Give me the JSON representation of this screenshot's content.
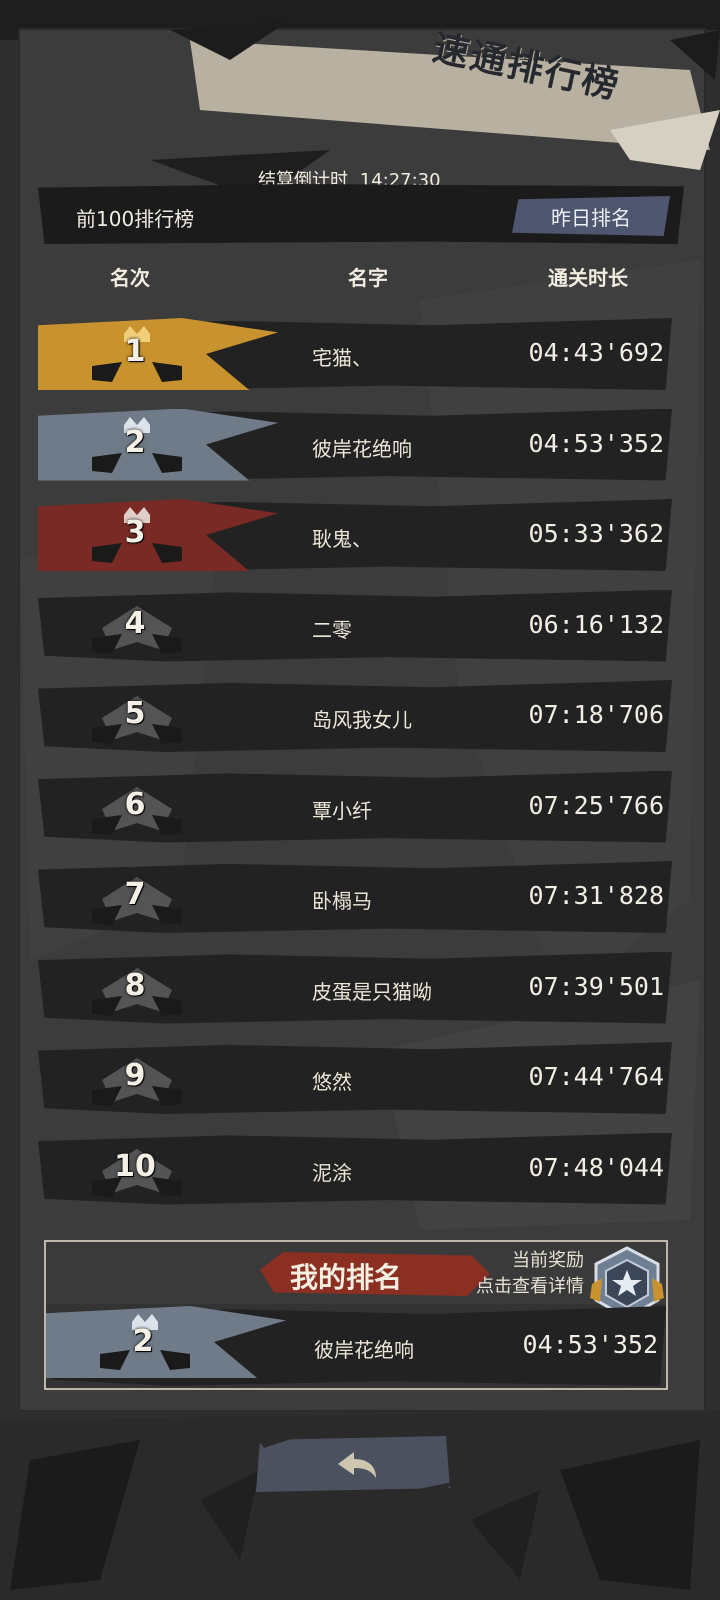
{
  "title": "速通排行榜",
  "countdown": {
    "label": "结算倒计时",
    "value": "14:27:30"
  },
  "board": {
    "label": "前100排行榜",
    "yesterday_button": "昨日排名",
    "columns": {
      "rank": "名次",
      "name": "名字",
      "time": "通关时长"
    }
  },
  "rows": [
    {
      "rank": "1",
      "name": "宅猫、",
      "time": "04:43'692",
      "tier": "gold"
    },
    {
      "rank": "2",
      "name": "彼岸花绝响",
      "time": "04:53'352",
      "tier": "silver"
    },
    {
      "rank": "3",
      "name": "耿鬼、",
      "time": "05:33'362",
      "tier": "bronze"
    },
    {
      "rank": "4",
      "name": "二零",
      "time": "06:16'132",
      "tier": "normal"
    },
    {
      "rank": "5",
      "name": "岛风我女儿",
      "time": "07:18'706",
      "tier": "normal"
    },
    {
      "rank": "6",
      "name": "覃小纤",
      "time": "07:25'766",
      "tier": "normal"
    },
    {
      "rank": "7",
      "name": "卧榻马",
      "time": "07:31'828",
      "tier": "normal"
    },
    {
      "rank": "8",
      "name": "皮蛋是只猫呦",
      "time": "07:39'501",
      "tier": "normal"
    },
    {
      "rank": "9",
      "name": "悠然",
      "time": "07:44'764",
      "tier": "normal"
    },
    {
      "rank": "10",
      "name": "泥涂",
      "time": "07:48'044",
      "tier": "normal"
    }
  ],
  "my_rank": {
    "title": "我的排名",
    "reward_line1": "当前奖励",
    "reward_line2": "点击查看详情",
    "rank": "2",
    "name": "彼岸花绝响",
    "time": "04:53'352",
    "tier": "silver"
  },
  "back_button_icon": "back-arrow-icon",
  "colors": {
    "gold": "#c8922e",
    "silver": "#6f7b88",
    "bronze": "#7a2a25",
    "row_bg": "#222222",
    "accent_red": "#8a2f22",
    "button_blue": "#4e5670"
  }
}
